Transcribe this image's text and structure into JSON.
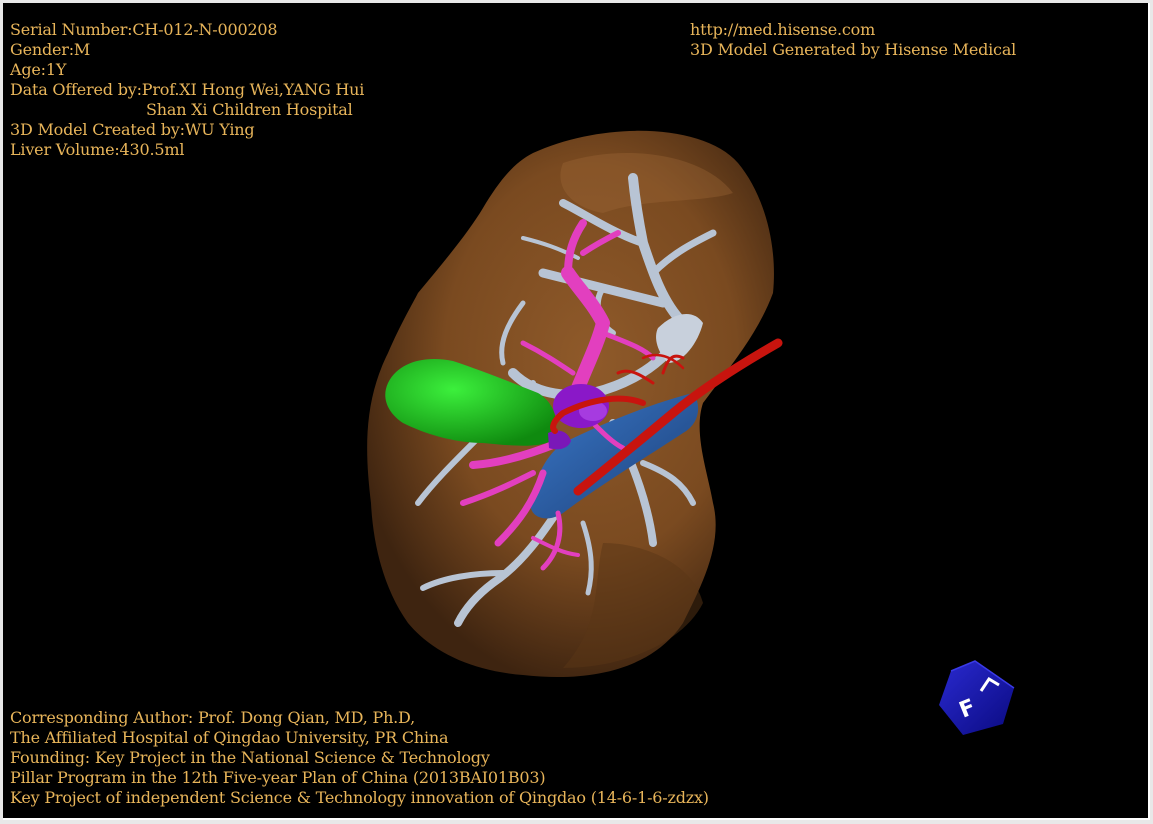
{
  "header_left": {
    "serial": "Serial Number:CH-012-N-000208",
    "gender": "Gender:M",
    "age": "Age:1Y",
    "data_offered": "Data Offered by:Prof.XI Hong Wei,YANG Hui",
    "hospital": "Shan Xi Children Hospital",
    "created_by": "3D Model Created by:WU Ying",
    "volume": "Liver Volume:430.5ml"
  },
  "header_right": {
    "url": "http://med.hisense.com",
    "generated": "3D Model Generated by Hisense Medical"
  },
  "footer": {
    "line1": "Corresponding Author: Prof. Dong Qian, MD, Ph.D,",
    "line2": "The Affiliated Hospital of Qingdao University, PR China",
    "line3": "Founding: Key Project in the National Science & Technology",
    "line4": "Pillar Program in the 12th Five-year Plan of China (2013BAI01B03)",
    "line5": "Key Project of independent Science & Technology innovation of Qingdao (14-6-1-6-zdzx)"
  },
  "orientation_cube": {
    "label": "F"
  },
  "colors": {
    "text": "#e8b55a",
    "liver": "#7a4a20",
    "gallbladder": "#1fd11f",
    "hepatic_vein": "#b8c4d4",
    "portal_vein": "#e23fbf",
    "artery": "#c8140e",
    "ivc": "#2a5fa8",
    "cube": "#1414a8"
  }
}
